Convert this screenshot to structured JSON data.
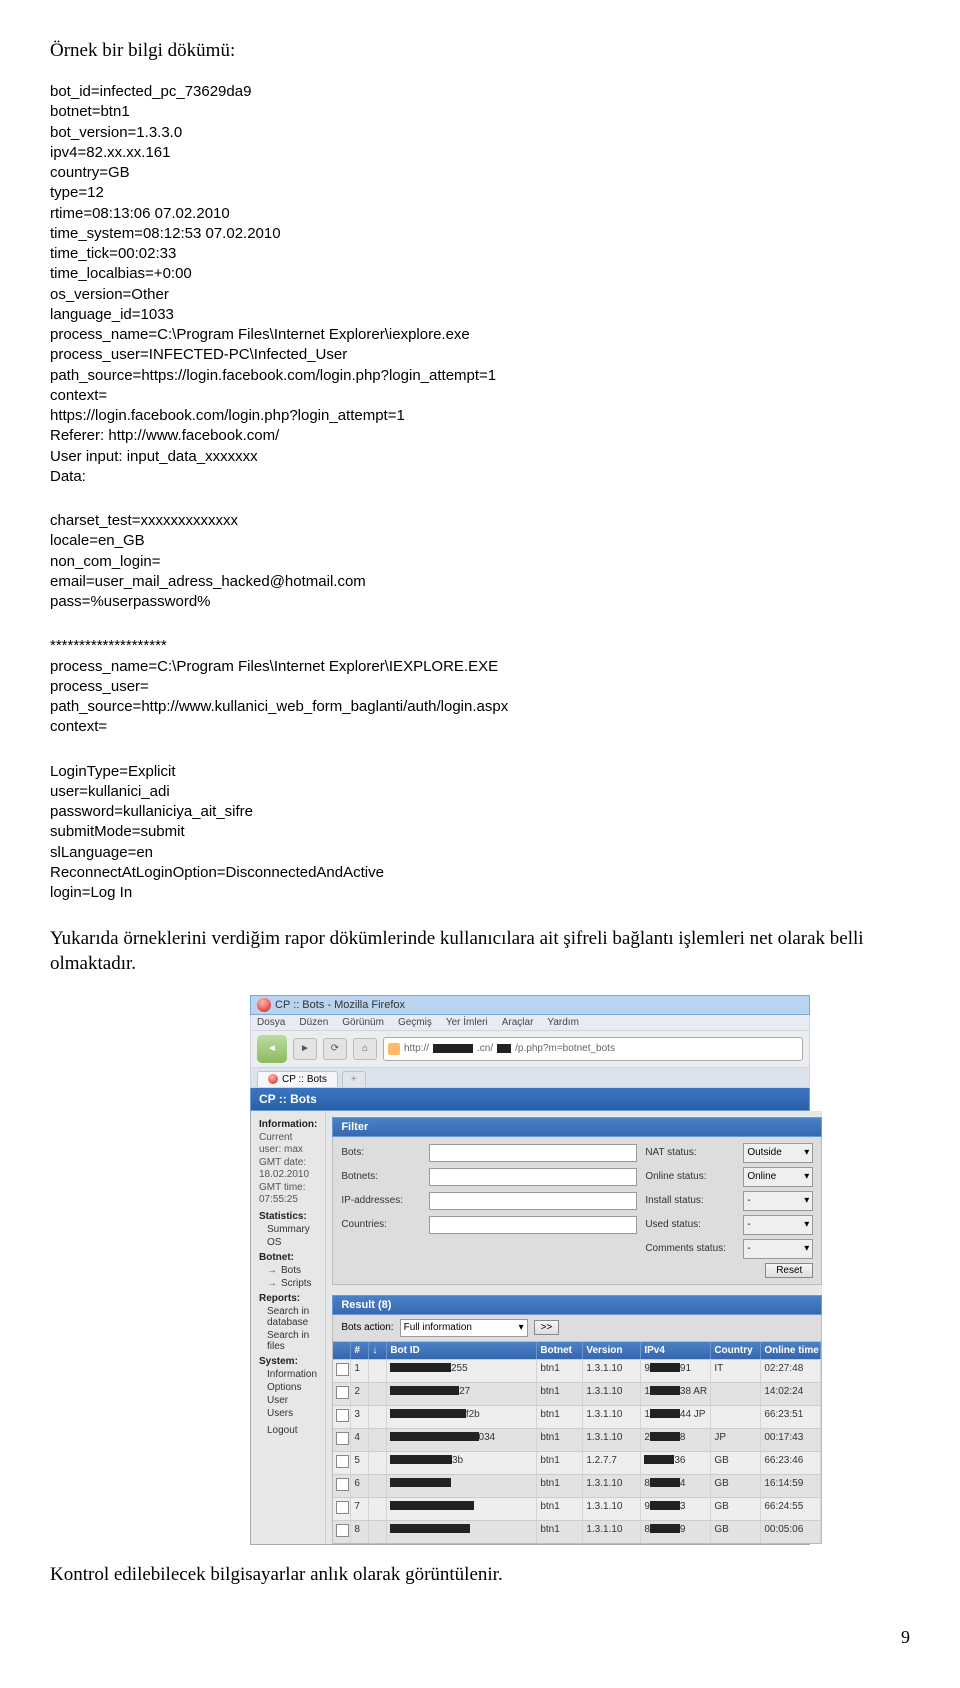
{
  "heading1": "Örnek bir bilgi dökümü:",
  "block1": [
    "bot_id=infected_pc_73629da9",
    "botnet=btn1",
    "bot_version=1.3.3.0",
    "ipv4=82.xx.xx.161",
    "country=GB",
    "type=12",
    "rtime=08:13:06 07.02.2010",
    "time_system=08:12:53 07.02.2010",
    "time_tick=00:02:33",
    "time_localbias=+0:00",
    "os_version=Other",
    "language_id=1033",
    "process_name=C:\\Program Files\\Internet Explorer\\iexplore.exe",
    "process_user=INFECTED-PC\\Infected_User",
    "path_source=https://login.facebook.com/login.php?login_attempt=1",
    "context=",
    "https://login.facebook.com/login.php?login_attempt=1",
    "Referer: http://www.facebook.com/",
    "User input: input_data_xxxxxxx",
    "Data:"
  ],
  "block2": [
    "charset_test=xxxxxxxxxxxxx",
    "locale=en_GB",
    "non_com_login=",
    "email=user_mail_adress_hacked@hotmail.com",
    "pass=%userpassword%"
  ],
  "block3": [
    "********************",
    "process_name=C:\\Program Files\\Internet Explorer\\IEXPLORE.EXE",
    "process_user=",
    "path_source=http://www.kullanici_web_form_baglanti/auth/login.aspx",
    "context="
  ],
  "block4": [
    "LoginType=Explicit",
    "user=kullanici_adi",
    "password=kullaniciya_ait_sifre",
    "submitMode=submit",
    "slLanguage=en",
    "ReconnectAtLoginOption=DisconnectedAndActive",
    "login=Log In"
  ],
  "narrative1": "Yukarıda örneklerini verdiğim rapor dökümlerinde kullanıcılara ait şifreli bağlantı işlemleri net olarak belli olmaktadır.",
  "narrative2": "Kontrol edilebilecek bilgisayarlar anlık olarak görüntülenir.",
  "page_num": "9",
  "ss": {
    "title": "CP :: Bots - Mozilla Firefox",
    "menu": [
      "Dosya",
      "Düzen",
      "Görünüm",
      "Geçmiş",
      "Yer İmleri",
      "Araçlar",
      "Yardım"
    ],
    "url_prefix": "http://",
    "url_host": ".cn/",
    "url_path": "/p.php?m=botnet_bots",
    "tab1": "CP :: Bots",
    "newtab": "+",
    "cpheader": "CP :: Bots",
    "sidebar": {
      "info_title": "Information:",
      "info_lines": [
        "Current user: max",
        "GMT date: 18.02.2010",
        "GMT time: 07:55:25"
      ],
      "stats_title": "Statistics:",
      "stats_items": [
        "Summary",
        "OS"
      ],
      "botnet_title": "Botnet:",
      "botnet_items": [
        "Bots",
        "Scripts"
      ],
      "reports_title": "Reports:",
      "reports_items": [
        "Search in database",
        "Search in files"
      ],
      "system_title": "System:",
      "system_items": [
        "Information",
        "Options",
        "User",
        "Users"
      ],
      "logout": "Logout"
    },
    "filter": {
      "header": "Filter",
      "left_labels": [
        "Bots:",
        "Botnets:",
        "IP-addresses:",
        "Countries:"
      ],
      "right_labels": [
        "NAT status:",
        "Online status:",
        "Install status:",
        "Used status:",
        "Comments status:"
      ],
      "right_values": [
        "Outside",
        "Online",
        "-",
        "-",
        "-"
      ],
      "reset": "Reset"
    },
    "result": {
      "header": "Result (8)",
      "action_label": "Bots action:",
      "action_value": "Full information",
      "go": ">>"
    },
    "thead": [
      "",
      "#",
      "↓",
      "Bot ID",
      "Botnet",
      "Version",
      "IPv4",
      "Country",
      "Online time"
    ],
    "rows": [
      {
        "n": "1",
        "id": "255",
        "bot": "btn1",
        "ver": "1.3.1.10",
        "ip": "9",
        "ipr": "91",
        "cc": "IT",
        "t": "02:27:48"
      },
      {
        "n": "2",
        "id": "27",
        "bot": "btn1",
        "ver": "1.3.1.10",
        "ip": "1",
        "ipr": "38 AR",
        "cc": "",
        "t": "14:02:24"
      },
      {
        "n": "3",
        "id": "f2b",
        "bot": "btn1",
        "ver": "1.3.1.10",
        "ip": "1",
        "ipr": "44 JP",
        "cc": "",
        "t": "66:23:51"
      },
      {
        "n": "4",
        "id": "034",
        "bot": "btn1",
        "ver": "1.3.1.10",
        "ip": "2",
        "ipr": "8",
        "cc": "JP",
        "t": "00:17:43"
      },
      {
        "n": "5",
        "id": "3b",
        "bot": "btn1",
        "ver": "1.2.7.7",
        "ip": "",
        "ipr": "36",
        "cc": "GB",
        "t": "66:23:46"
      },
      {
        "n": "6",
        "id": "",
        "bot": "btn1",
        "ver": "1.3.1.10",
        "ip": "8",
        "ipr": "4",
        "cc": "GB",
        "t": "16:14:59"
      },
      {
        "n": "7",
        "id": "",
        "bot": "btn1",
        "ver": "1.3.1.10",
        "ip": "9",
        "ipr": "3",
        "cc": "GB",
        "t": "66:24:55"
      },
      {
        "n": "8",
        "id": "",
        "bot": "btn1",
        "ver": "1.3.1.10",
        "ip": "8",
        "ipr": "9",
        "cc": "GB",
        "t": "00:05:06"
      }
    ]
  }
}
